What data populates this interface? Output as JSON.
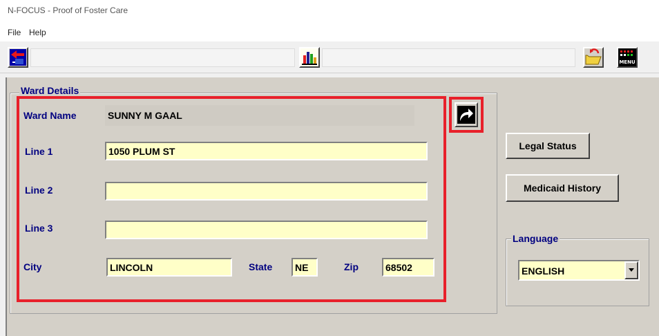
{
  "window": {
    "title": "N-FOCUS - Proof of Foster Care"
  },
  "menu": {
    "file": "File",
    "help": "Help"
  },
  "toolbar": {
    "exit_icon": "exit-door-icon",
    "chart_icon": "bar-chart-icon",
    "folder_icon": "open-folder-icon",
    "menu_icon_text": "MENU"
  },
  "ward": {
    "group_title": "Ward Details",
    "name_label": "Ward Name",
    "name_value": "SUNNY M GAAL",
    "line1_label": "Line 1",
    "line1_value": "1050 PLUM ST",
    "line2_label": "Line 2",
    "line2_value": "",
    "line3_label": "Line 3",
    "line3_value": "",
    "city_label": "City",
    "city_value": "LINCOLN",
    "state_label": "State",
    "state_value": "NE",
    "zip_label": "Zip",
    "zip_value": "68502"
  },
  "buttons": {
    "legal_status": "Legal Status",
    "medicaid_history": "Medicaid History"
  },
  "language": {
    "group_title": "Language",
    "selected": "ENGLISH"
  },
  "colors": {
    "highlight": "#e8202a",
    "label": "#000080",
    "field": "#ffffc8"
  }
}
